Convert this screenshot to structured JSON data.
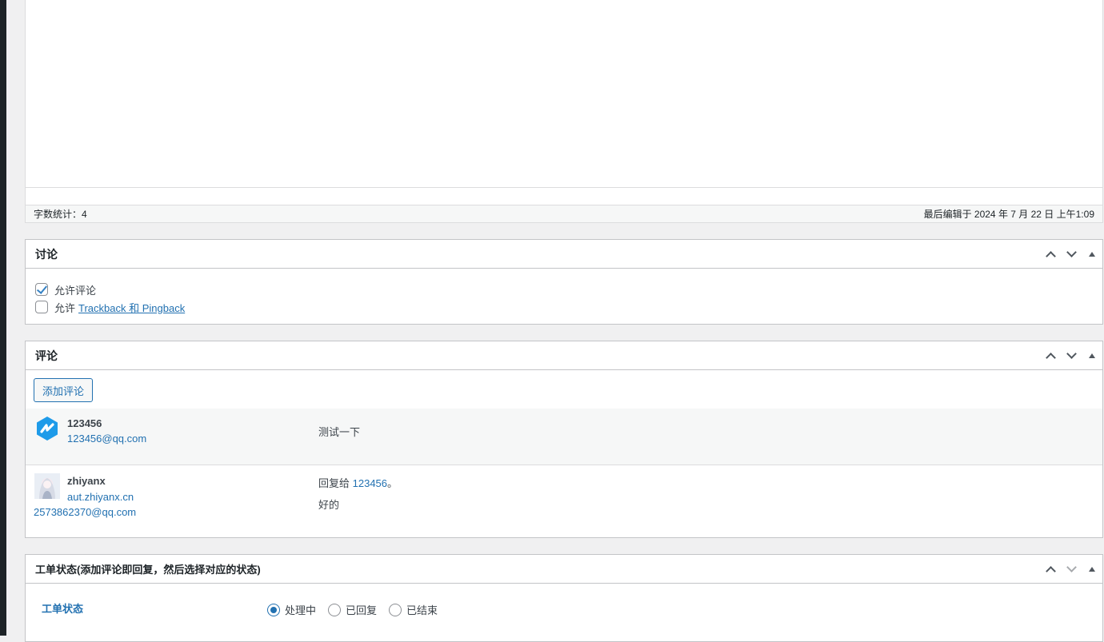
{
  "editor": {
    "word_count": "字数统计：4",
    "last_edited": "最后编辑于 2024 年 7 月 22 日 上午1:09"
  },
  "discussion": {
    "title": "讨论",
    "allow_comments_label": "允许评论",
    "allow_comments_checked": true,
    "allow_trackback_prefix": "允许",
    "allow_trackback_link": "Trackback 和 Pingback",
    "allow_trackback_checked": false
  },
  "comments": {
    "title": "评论",
    "add_button": "添加评论",
    "items": [
      {
        "author": "123456",
        "email": "123456@qq.com",
        "text": "测试一下"
      },
      {
        "author": "zhiyanx",
        "url": "aut.zhiyanx.cn",
        "email": "2573862370@qq.com",
        "reply_prefix": "回复给",
        "reply_to": "123456",
        "reply_suffix": "。",
        "text": "好的"
      }
    ]
  },
  "ticket": {
    "title": "工单状态(添加评论即回复，然后选择对应的状态)",
    "label": "工单状态",
    "options": [
      "处理中",
      "已回复",
      "已结束"
    ],
    "selected": "处理中"
  },
  "colors": {
    "accent": "#2271b1",
    "avatar_blue": "#1e9be9"
  }
}
